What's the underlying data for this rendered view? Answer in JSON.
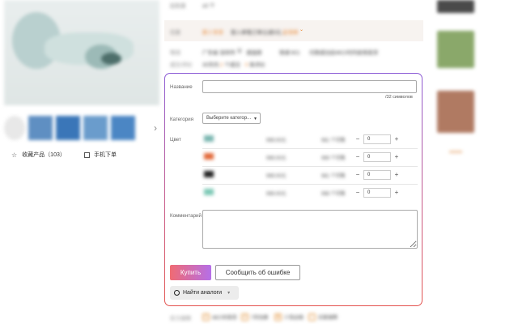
{
  "top": {
    "stock_label": "起批量",
    "stock_value": "≥2 个"
  },
  "promo": {
    "label": "优惠",
    "tag": "新人专享",
    "text": "首入单笔订单立减5元...",
    "link": "去领单"
  },
  "shipping": {
    "label": "物流",
    "from": "广东省 深圳市",
    "to": "请选择",
    "fee": "快递 ¥21",
    "note": "付款成功后48小时内安排发货"
  },
  "sales": {
    "label": "成交/评价",
    "text": "30天内",
    "count": "2",
    "unit": "个成交",
    "reviews_count": "0",
    "reviews_label": "条评价"
  },
  "form": {
    "name_label": "Название",
    "name_value": "",
    "name_hint": "/32 символов",
    "category_label": "Категория",
    "category_value": "Выберите категор...",
    "color_label": "Цвет",
    "colors": [
      {
        "price": "999.00元",
        "available": "981 个可售",
        "qty": "0",
        "swatch": "#7ab6b0"
      },
      {
        "price": "999.00元",
        "available": "999 个可售",
        "qty": "0",
        "swatch": "#e26a3b"
      },
      {
        "price": "999.00元",
        "available": "981 个可售",
        "qty": "0",
        "swatch": "#222222"
      },
      {
        "price": "999.00元",
        "available": "998 个可售",
        "qty": "0",
        "swatch": "#7dc9b6"
      }
    ],
    "comment_label": "Комментарий",
    "comment_value": "",
    "buy_label": "Купить",
    "report_label": "Сообщить об ошибке",
    "analog_label": "Найти аналоги"
  },
  "left": {
    "favorite_label": "收藏产品（103）",
    "mobile_label": "手机下单"
  },
  "service": {
    "label": "实力保障",
    "items": [
      "48小时发货",
      "7天包换",
      "少货必赔",
      "买家保障"
    ]
  },
  "colors": {
    "accent_orange": "#e8822a",
    "accent_red": "#e4534e",
    "accent_purple": "#8b5bd6"
  },
  "icons": {
    "star": "star-icon",
    "qr": "qr-code-icon",
    "search": "search-icon",
    "chevron": "chevron-down-icon",
    "next": "chevron-right-icon"
  }
}
